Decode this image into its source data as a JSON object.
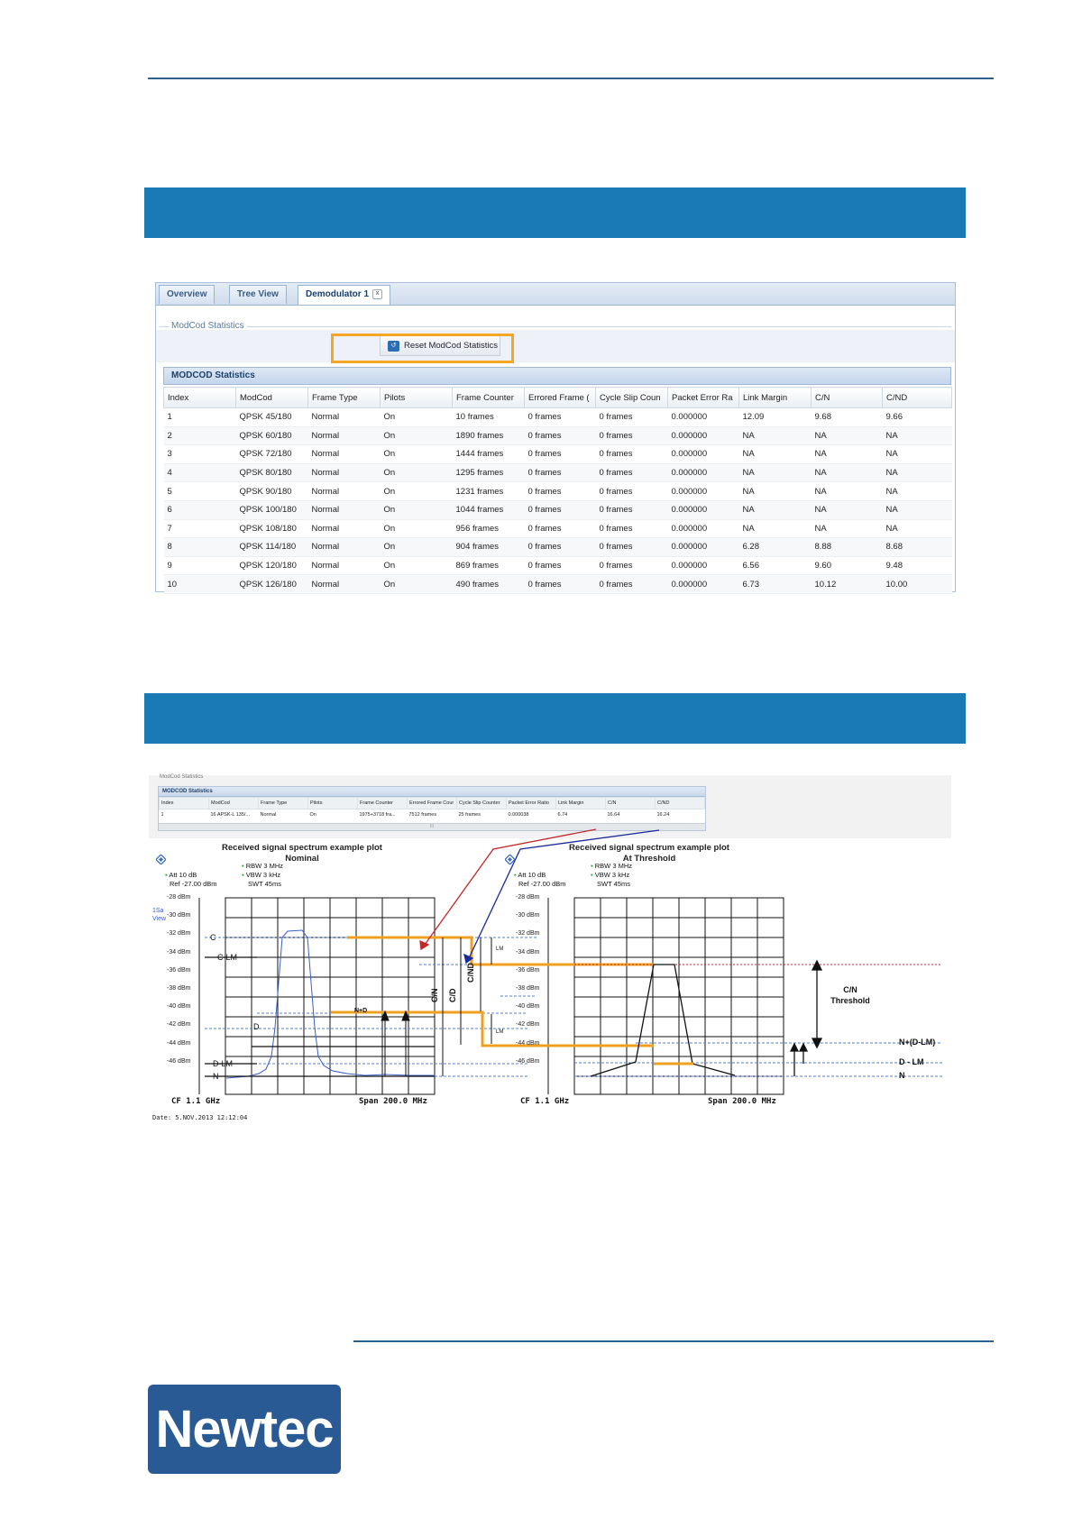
{
  "ui": {
    "tabs": [
      {
        "label": "Overview"
      },
      {
        "label": "Tree View"
      },
      {
        "label": "Demodulator 1"
      }
    ],
    "fieldset_legend": "ModCod Statistics",
    "reset_button_label": "Reset ModCod Statistics",
    "grid_title": "MODCOD Statistics",
    "columns": [
      "Index",
      "ModCod",
      "Frame Type",
      "Pilots",
      "Frame Counter",
      "Errored Frame (",
      "Cycle Slip Coun",
      "Packet Error Ra",
      "Link Margin",
      "C/N",
      "C/ND"
    ],
    "rows": [
      [
        "1",
        "QPSK 45/180",
        "Normal",
        "On",
        "10 frames",
        "0 frames",
        "0 frames",
        "0.000000",
        "12.09",
        "9.68",
        "9.66"
      ],
      [
        "2",
        "QPSK 60/180",
        "Normal",
        "On",
        "1890 frames",
        "0 frames",
        "0 frames",
        "0.000000",
        "NA",
        "NA",
        "NA"
      ],
      [
        "3",
        "QPSK 72/180",
        "Normal",
        "On",
        "1444 frames",
        "0 frames",
        "0 frames",
        "0.000000",
        "NA",
        "NA",
        "NA"
      ],
      [
        "4",
        "QPSK 80/180",
        "Normal",
        "On",
        "1295 frames",
        "0 frames",
        "0 frames",
        "0.000000",
        "NA",
        "NA",
        "NA"
      ],
      [
        "5",
        "QPSK 90/180",
        "Normal",
        "On",
        "1231 frames",
        "0 frames",
        "0 frames",
        "0.000000",
        "NA",
        "NA",
        "NA"
      ],
      [
        "6",
        "QPSK 100/180",
        "Normal",
        "On",
        "1044 frames",
        "0 frames",
        "0 frames",
        "0.000000",
        "NA",
        "NA",
        "NA"
      ],
      [
        "7",
        "QPSK 108/180",
        "Normal",
        "On",
        "956 frames",
        "0 frames",
        "0 frames",
        "0.000000",
        "NA",
        "NA",
        "NA"
      ],
      [
        "8",
        "QPSK 114/180",
        "Normal",
        "On",
        "904 frames",
        "0 frames",
        "0 frames",
        "0.000000",
        "6.28",
        "8.88",
        "8.68"
      ],
      [
        "9",
        "QPSK 120/180",
        "Normal",
        "On",
        "869 frames",
        "0 frames",
        "0 frames",
        "0.000000",
        "6.56",
        "9.60",
        "9.48"
      ],
      [
        "10",
        "QPSK 126/180",
        "Normal",
        "On",
        "490 frames",
        "0 frames",
        "0 frames",
        "0.000000",
        "6.73",
        "10.12",
        "10.00"
      ]
    ]
  },
  "mini": {
    "legend": "ModCod Statistics",
    "title": "MODCOD Statistics",
    "columns": [
      "Index",
      "ModCod",
      "Frame Type",
      "Pilots",
      "Frame Counter",
      "Errored Frame Cour",
      "Cycle Slip Counter",
      "Packet Error Ratio",
      "Link Margin",
      "C/N",
      "C/ND"
    ],
    "row": [
      "1",
      "16 APSK-L 135/...",
      "Normal",
      "On",
      "1975+3718 fra...",
      "7512 frames",
      "25 frames",
      "0.000038",
      "6.74",
      "16.64",
      "16.24"
    ],
    "scroll": "III"
  },
  "plots": {
    "nominal": {
      "title": "Received signal spectrum example plot",
      "subtitle": "Nominal",
      "rbw": "RBW  3 MHz",
      "vbw": "VBW  3 kHz",
      "swt": "SWT  45ms",
      "att": "Att   10 dB",
      "ref": "Ref  -27.00 dBm",
      "view": "1Sa\nView",
      "cf": "CF 1.1 GHz",
      "span": "Span 200.0 MHz",
      "date": "Date: 5.NOV.2013  12:12:04",
      "labels": {
        "c": "C",
        "clm": "C-LM",
        "d": "D",
        "dlm": "D-LM",
        "n": "N",
        "npd": "N+D",
        "cn": "C/N",
        "cd": "C/D",
        "cnd": "C/ND",
        "lm1": "LM",
        "lm2": "LM"
      }
    },
    "threshold": {
      "title": "Received signal spectrum example plot",
      "subtitle": "At Threshold",
      "rbw": "RBW  3 MHz",
      "vbw": "VBW  3 kHz",
      "swt": "SWT  45ms",
      "att": "Att   10 dB",
      "ref": "Ref  -27.00 dBm",
      "cf": "CF 1.1 GHz",
      "span": "Span 200.0 MHz",
      "labels": {
        "cn_thr": "C/N\nThreshold",
        "ndlm": "N+(D-LM)",
        "dlm": "D - LM",
        "n": "N"
      }
    },
    "y_ticks": [
      "-28 dBm",
      "-30 dBm",
      "-32 dBm",
      "-34 dBm",
      "-36 dBm",
      "-38 dBm",
      "-40 dBm",
      "-42 dBm",
      "-44 dBm",
      "-46 dBm"
    ]
  },
  "logo": {
    "text": "Newtec"
  },
  "colors": {
    "accent_band": "#1a7ab5",
    "highlight": "#f5a623",
    "orange_line": "#f0a020",
    "red_arrow": "#c0282a",
    "blue_arrow": "#1a2a9a",
    "logo_bg": "#2a5a93"
  }
}
